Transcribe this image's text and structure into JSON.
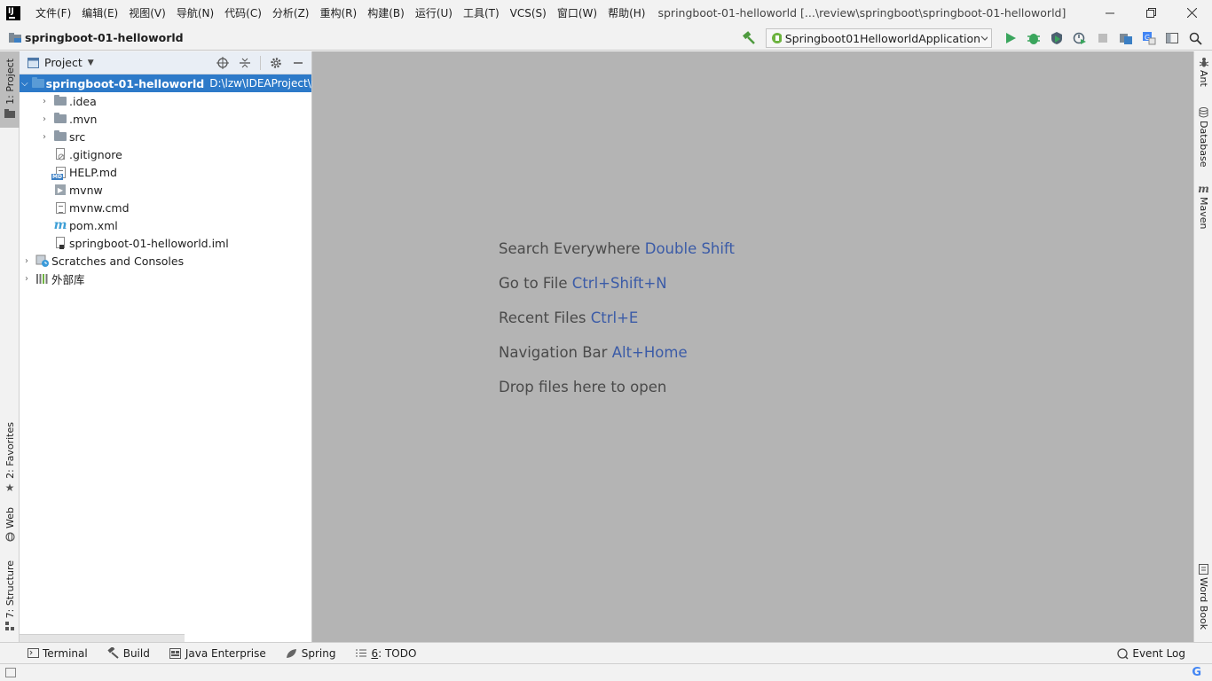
{
  "window": {
    "title": "springboot-01-helloworld [...\\review\\springboot\\springboot-01-helloworld]",
    "logo_text": "IJ"
  },
  "menu": [
    "文件(F)",
    "编辑(E)",
    "视图(V)",
    "导航(N)",
    "代码(C)",
    "分析(Z)",
    "重构(R)",
    "构建(B)",
    "运行(U)",
    "工具(T)",
    "VCS(S)",
    "窗口(W)",
    "帮助(H)"
  ],
  "navbar": {
    "project_name": "springboot-01-helloworld",
    "run_config": "Springboot01HelloworldApplication"
  },
  "left_tabs": {
    "project": "1: Project",
    "favorites": "2: Favorites",
    "web": "Web",
    "structure": "7: Structure"
  },
  "right_tabs": {
    "ant": "Ant",
    "database": "Database",
    "maven": "Maven",
    "wordbook": "Word Book"
  },
  "project_panel": {
    "title": "Project",
    "tree": [
      {
        "label": "springboot-01-helloworld",
        "path": "D:\\lzw\\IDEAProject\\re"
      },
      {
        "label": ".idea"
      },
      {
        "label": ".mvn"
      },
      {
        "label": "src"
      },
      {
        "label": ".gitignore"
      },
      {
        "label": "HELP.md",
        "badge": "MD"
      },
      {
        "label": "mvnw"
      },
      {
        "label": "mvnw.cmd"
      },
      {
        "label": "pom.xml",
        "badge": "m"
      },
      {
        "label": "springboot-01-helloworld.iml"
      },
      {
        "label": "Scratches and Consoles"
      },
      {
        "label": "外部库"
      }
    ]
  },
  "editor_hints": [
    {
      "text": "Search Everywhere",
      "key": "Double Shift"
    },
    {
      "text": "Go to File",
      "key": "Ctrl+Shift+N"
    },
    {
      "text": "Recent Files",
      "key": "Ctrl+E"
    },
    {
      "text": "Navigation Bar",
      "key": "Alt+Home"
    },
    {
      "text": "Drop files here to open",
      "key": ""
    }
  ],
  "bottom_tabs": {
    "terminal": "Terminal",
    "build": "Build",
    "java_enterprise": "Java Enterprise",
    "spring": "Spring",
    "todo_num": "6",
    "todo": ": TODO",
    "event_log": "Event Log"
  },
  "status": {
    "g_logo": "G"
  }
}
